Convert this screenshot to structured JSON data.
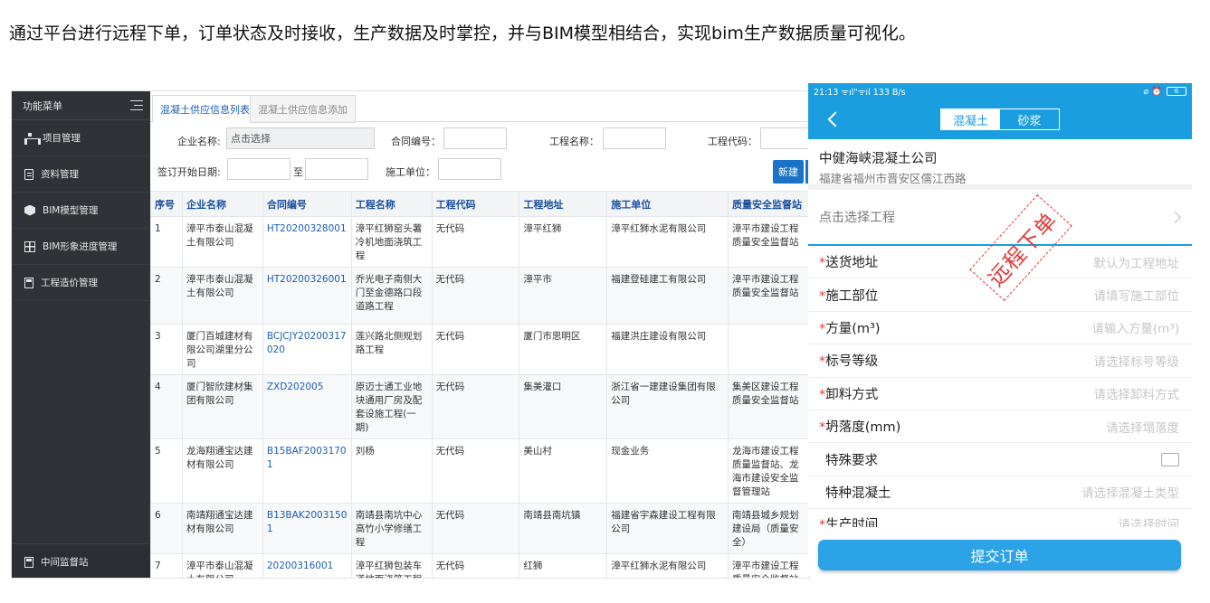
{
  "caption": "通过平台进行远程下单，订单状态及时接收，生产数据及时掌控，并与BIM模型相结合，实现bim生产数据质量可视化。",
  "desktop": {
    "sidebar": {
      "header": "功能菜单",
      "items": [
        {
          "label": "项目管理",
          "icon": "org-tree-icon"
        },
        {
          "label": "资料管理",
          "icon": "document-icon"
        },
        {
          "label": "BIM模型管理",
          "icon": "cube-icon"
        },
        {
          "label": "BIM形象进度管理",
          "icon": "grid-icon"
        },
        {
          "label": "工程造价管理",
          "icon": "calculator-icon"
        }
      ],
      "bottom_item": "中间监督站"
    },
    "tabs": [
      "混凝土供应信息列表",
      "混凝土供应信息添加"
    ],
    "filters": {
      "company_label": "企业名称:",
      "company_placeholder": "点击选择",
      "contract_label": "合同编号：",
      "project_label": "工程名称：",
      "code_label": "工程代码：",
      "date_label": "签订开始日期:",
      "to_label": "至",
      "builder_label": "施工单位："
    },
    "new_button": "新建",
    "columns": [
      "序号",
      "企业名称",
      "合同编号",
      "工程名称",
      "工程代码",
      "工程地址",
      "施工单位",
      "质量安全监督站"
    ],
    "rows": [
      {
        "no": "1",
        "company": "漳平市泰山混凝土有限公司",
        "contract": "HT20200328001",
        "project": "漳平红狮窑头薯冷机地面浇筑工程",
        "code": "无代码",
        "address": "漳平红狮",
        "builder": "漳平红狮水泥有限公司",
        "station": "漳平市建设工程质量安全监督站"
      },
      {
        "no": "2",
        "company": "漳平市泰山混凝土有限公司",
        "contract": "HT20200326001",
        "project": "乔光电子南侧大门至金德路口段道路工程",
        "code": "无代码",
        "address": "漳平市",
        "builder": "福建登硅建工有限公司",
        "station": "漳平市建设工程质量安全监督站"
      },
      {
        "no": "3",
        "company": "厦门百城建材有限公司湖里分公司",
        "contract": "BCJCJY20200317020",
        "project": "莲兴路北侧规划路工程",
        "code": "无代码",
        "address": "厦门市思明区",
        "builder": "福建洪庄建设有限公司",
        "station": ""
      },
      {
        "no": "4",
        "company": "厦门智欣建材集团有限公司",
        "contract": "ZXD202005",
        "project": "原迈士通工业地块通用厂房及配套设施工程(一期)",
        "code": "无代码",
        "address": "集美灌口",
        "builder": "浙江省一建建设集团有限公司",
        "station": "集美区建设工程质量安全监督站"
      },
      {
        "no": "5",
        "company": "龙海翔通宝达建材有限公司",
        "contract": "B15BAF20031701",
        "project": "刘杨",
        "code": "无代码",
        "address": "美山村",
        "builder": "现金业务",
        "station": "龙海市建设工程质量监督站、龙海市建设安全监督管理站"
      },
      {
        "no": "6",
        "company": "南靖翔通宝达建材有限公司",
        "contract": "B13BAK20031501",
        "project": "南靖县南坑中心高竹小学修缮工程",
        "code": "无代码",
        "address": "南靖县南坑镇",
        "builder": "福建省宇森建设工程有限公司",
        "station": "南靖县城乡规划建设局（质量安全）"
      },
      {
        "no": "7",
        "company": "漳平市泰山混凝土有限公司",
        "contract": "20200316001",
        "project": "漳平红狮包装车道地面浇筑工程",
        "code": "无代码",
        "address": "红狮",
        "builder": "漳平红狮水泥有限公司",
        "station": "漳平市建设工程质量安全监督站"
      }
    ]
  },
  "phone": {
    "status": {
      "time": "21:13",
      "signal": "ᯤıl\"ᯤıl",
      "speed": "133 B/s",
      "icons": "⌀ ⏰",
      "battery": "6"
    },
    "segments": [
      "混凝土",
      "砂浆"
    ],
    "company_name": "中健海峡混凝土公司",
    "company_address": "福建省福州市晋安区儒江西路",
    "pick_project": "点击选择工程",
    "stamp": "远程下单",
    "fields": [
      {
        "label": "送货地址",
        "placeholder": "默认为工程地址",
        "required": "*"
      },
      {
        "label": "施工部位",
        "placeholder": "请填写施工部位",
        "required": "*"
      },
      {
        "label": "方量(m³)",
        "placeholder": "请输入方量(m³)",
        "required": "*"
      },
      {
        "label": "标号等级",
        "placeholder": "请选择标号等级",
        "required": "*"
      },
      {
        "label": "卸料方式",
        "placeholder": "请选择卸料方式",
        "required": "*"
      },
      {
        "label": "坍落度(mm)",
        "placeholder": "请选择塌落度",
        "required": "*"
      }
    ],
    "special_label": "特殊要求",
    "special_concrete_label": "特种混凝土",
    "special_concrete_placeholder": "请选择混凝土类型",
    "cut_label": "生产时间",
    "cut_placeholder": "请选择时间",
    "submit": "提交订单"
  }
}
